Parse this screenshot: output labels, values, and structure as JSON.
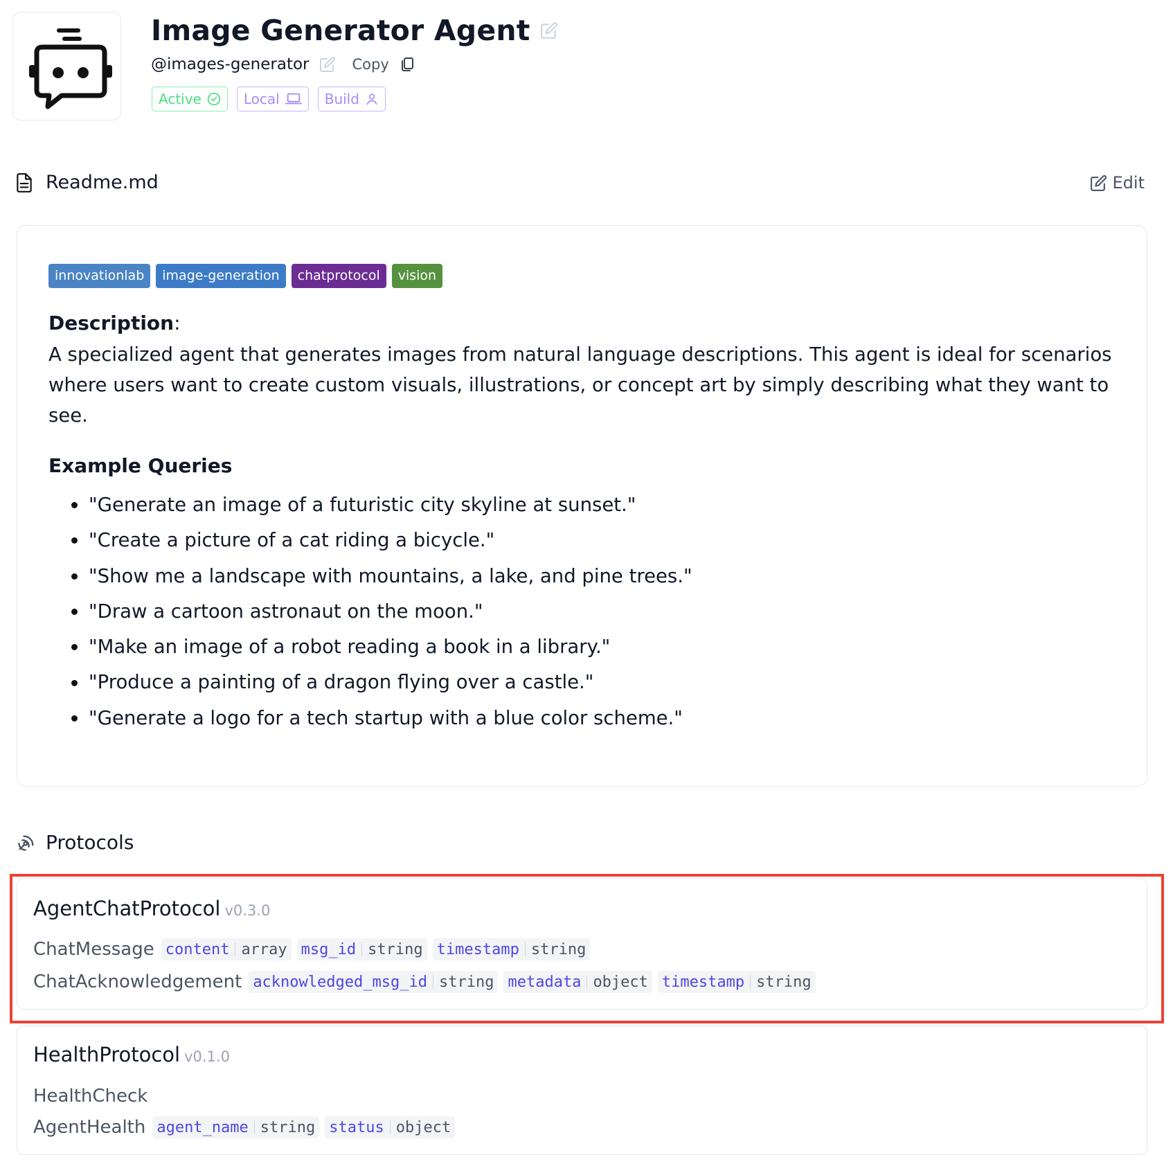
{
  "agent": {
    "title": "Image Generator Agent",
    "handle": "@images-generator",
    "copy_label": "Copy",
    "badges": {
      "active": "Active",
      "local": "Local",
      "build": "Build"
    }
  },
  "readme": {
    "title": "Readme.md",
    "edit_label": "Edit",
    "tags": [
      {
        "label": "innovationlab",
        "color": "#4a84c4"
      },
      {
        "label": "image-generation",
        "color": "#3d7bc6"
      },
      {
        "label": "chatprotocol",
        "color": "#6b2d93"
      },
      {
        "label": "vision",
        "color": "#55923f"
      }
    ],
    "description_label": "Description",
    "description_colon": ":",
    "description": "A specialized agent that generates images from natural language descriptions. This agent is ideal for scenarios where users want to create custom visuals, illustrations, or concept art by simply describing what they want to see.",
    "examples_title": "Example Queries",
    "examples": [
      "\"Generate an image of a futuristic city skyline at sunset.\"",
      "\"Create a picture of a cat riding a bicycle.\"",
      "\"Show me a landscape with mountains, a lake, and pine trees.\"",
      "\"Draw a cartoon astronaut on the moon.\"",
      "\"Make an image of a robot reading a book in a library.\"",
      "\"Produce a painting of a dragon flying over a castle.\"",
      "\"Generate a logo for a tech startup with a blue color scheme.\""
    ]
  },
  "protocols": {
    "title": "Protocols",
    "items": [
      {
        "name": "AgentChatProtocol",
        "version": "v0.3.0",
        "messages": [
          {
            "name": "ChatMessage",
            "fields": [
              {
                "name": "content",
                "type": "array"
              },
              {
                "name": "msg_id",
                "type": "string"
              },
              {
                "name": "timestamp",
                "type": "string"
              }
            ]
          },
          {
            "name": "ChatAcknowledgement",
            "fields": [
              {
                "name": "acknowledged_msg_id",
                "type": "string"
              },
              {
                "name": "metadata",
                "type": "object"
              },
              {
                "name": "timestamp",
                "type": "string"
              }
            ]
          }
        ]
      },
      {
        "name": "HealthProtocol",
        "version": "v0.1.0",
        "messages": [
          {
            "name": "HealthCheck",
            "fields": []
          },
          {
            "name": "AgentHealth",
            "fields": [
              {
                "name": "agent_name",
                "type": "string"
              },
              {
                "name": "status",
                "type": "object"
              }
            ]
          }
        ]
      }
    ]
  }
}
